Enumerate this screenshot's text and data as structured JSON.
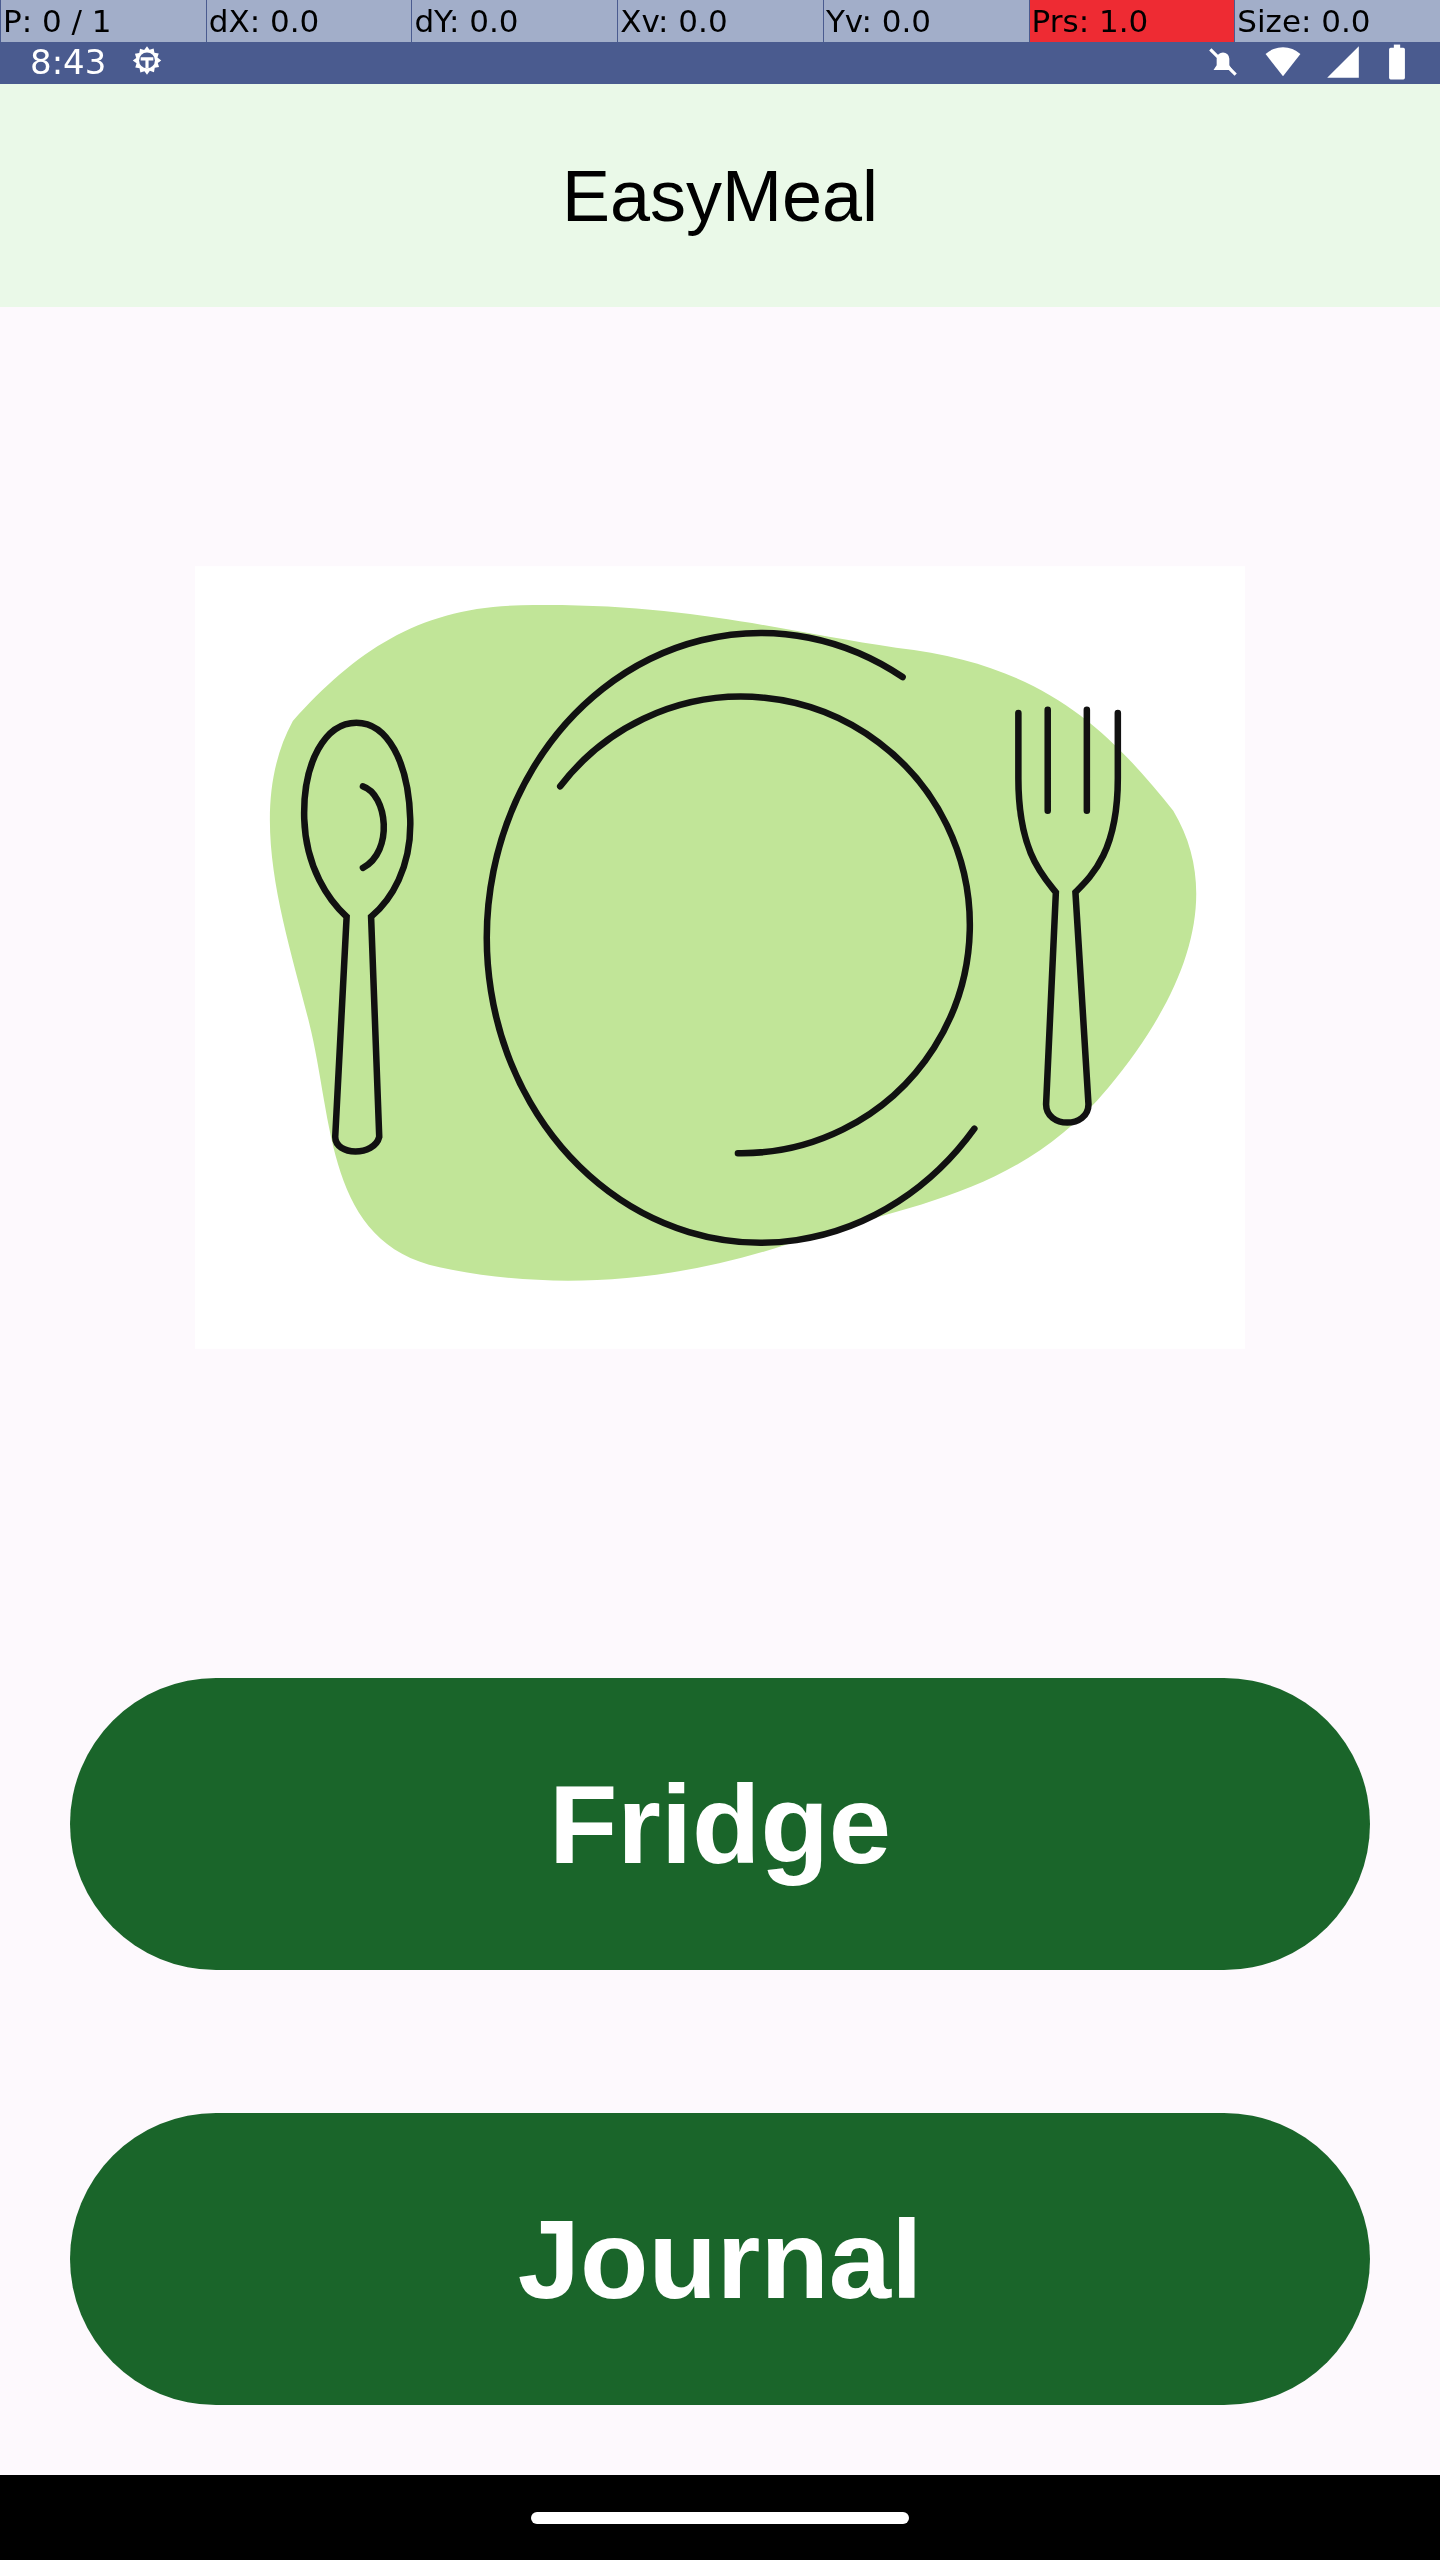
{
  "pointer_overlay": [
    {
      "label": "P: 0 / 1",
      "color": "#a2aec9"
    },
    {
      "label": "dX: 0.0",
      "color": "#a2aec9"
    },
    {
      "label": "dY: 0.0",
      "color": "#a2aec9"
    },
    {
      "label": "Xv: 0.0",
      "color": "#a2aec9"
    },
    {
      "label": "Yv: 0.0",
      "color": "#a2aec9"
    },
    {
      "label": "Prs: 1.0",
      "color": "#ee2b33"
    },
    {
      "label": "Size: 0.0",
      "color": "#a2aec9"
    }
  ],
  "status_bar": {
    "time": "8:43"
  },
  "app_bar": {
    "title": "EasyMeal"
  },
  "buttons": [
    "Fridge",
    "Journal"
  ]
}
